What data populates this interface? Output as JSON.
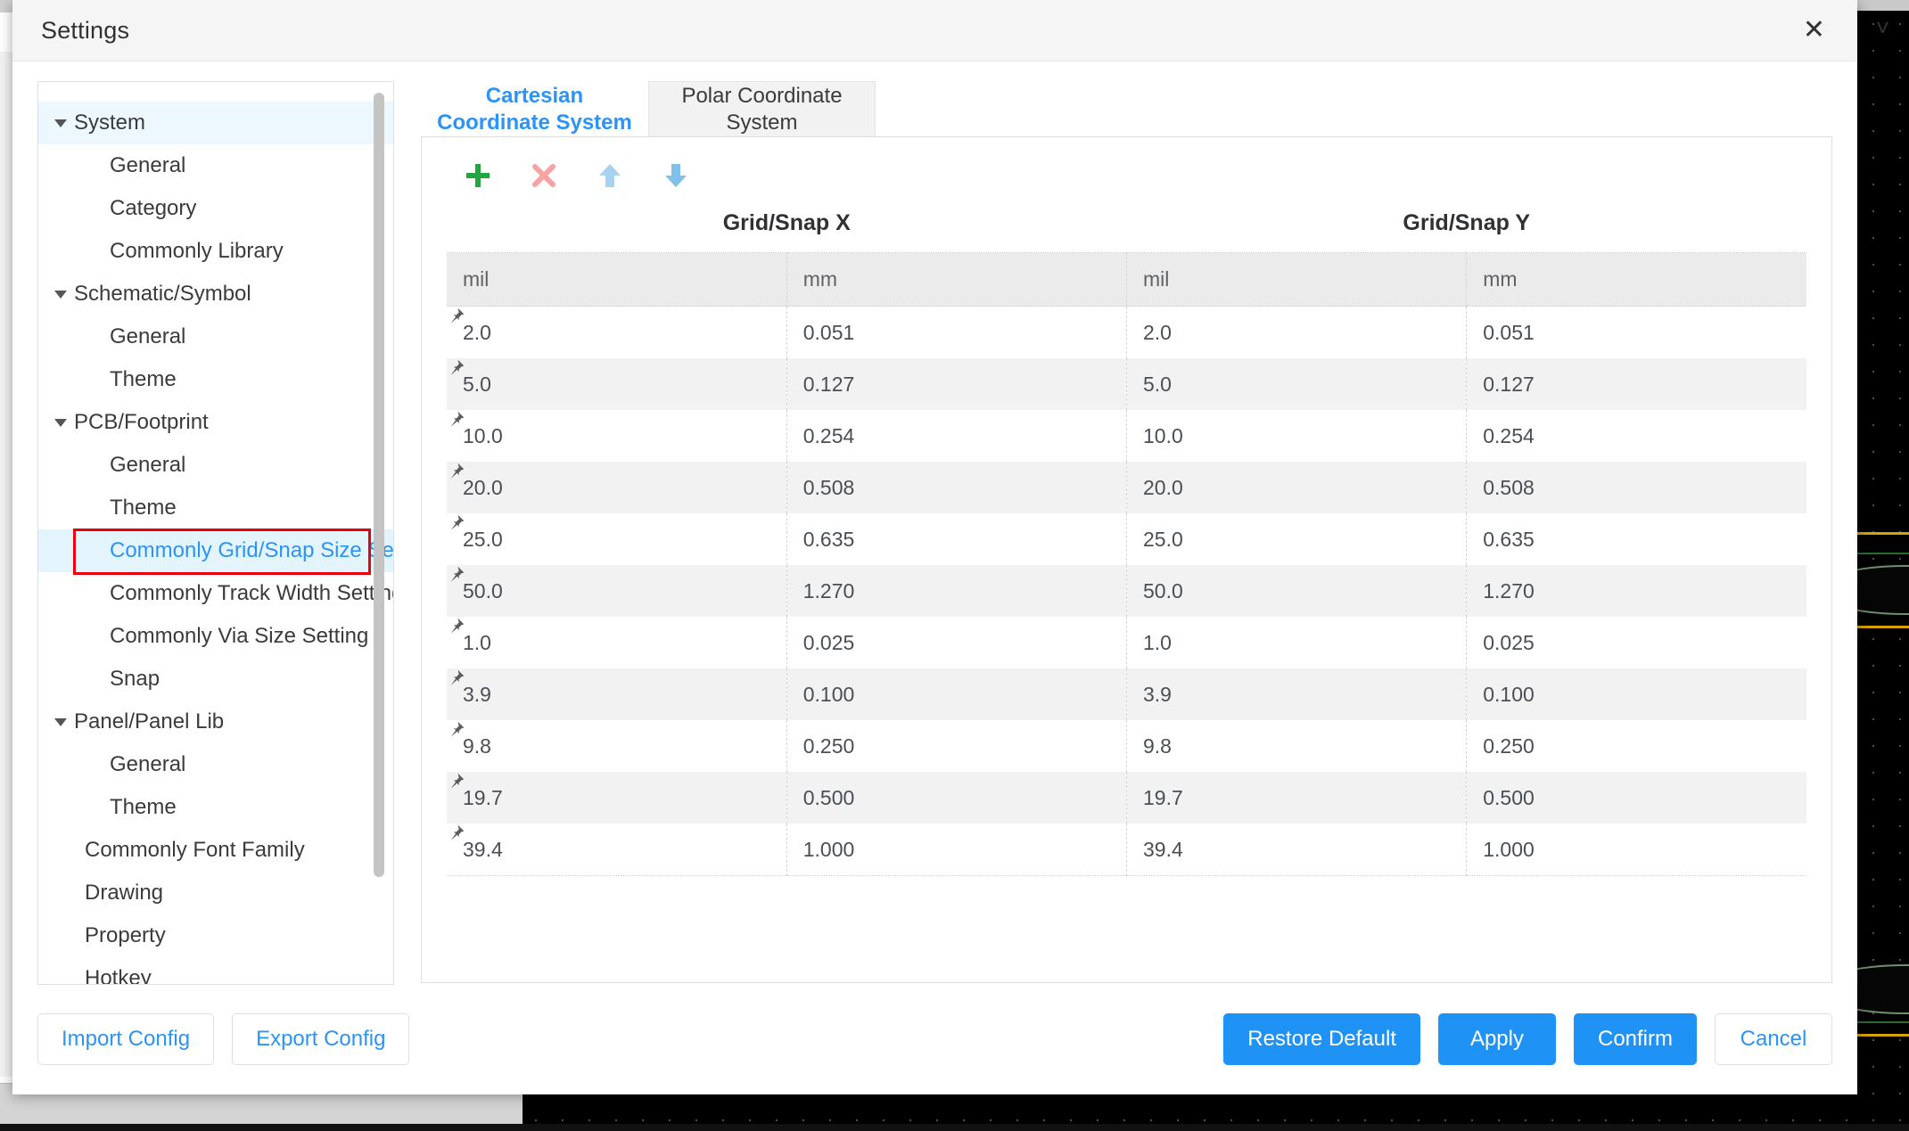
{
  "dialog": {
    "title": "Settings",
    "close_icon": "close-icon"
  },
  "sidebar": {
    "items": [
      {
        "label": "System",
        "level": 0,
        "expandable": true,
        "state": "selected-parent"
      },
      {
        "label": "General",
        "level": 1,
        "expandable": false,
        "state": ""
      },
      {
        "label": "Category",
        "level": 1,
        "expandable": false,
        "state": ""
      },
      {
        "label": "Commonly Library",
        "level": 1,
        "expandable": false,
        "state": ""
      },
      {
        "label": "Schematic/Symbol",
        "level": 0,
        "expandable": true,
        "state": ""
      },
      {
        "label": "General",
        "level": 1,
        "expandable": false,
        "state": ""
      },
      {
        "label": "Theme",
        "level": 1,
        "expandable": false,
        "state": ""
      },
      {
        "label": "PCB/Footprint",
        "level": 0,
        "expandable": true,
        "state": ""
      },
      {
        "label": "General",
        "level": 1,
        "expandable": false,
        "state": ""
      },
      {
        "label": "Theme",
        "level": 1,
        "expandable": false,
        "state": ""
      },
      {
        "label": "Commonly Grid/Snap Size Setting",
        "level": 1,
        "expandable": false,
        "state": "active"
      },
      {
        "label": "Commonly Track Width Setting",
        "level": 1,
        "expandable": false,
        "state": ""
      },
      {
        "label": "Commonly Via Size Setting",
        "level": 1,
        "expandable": false,
        "state": ""
      },
      {
        "label": "Snap",
        "level": 1,
        "expandable": false,
        "state": ""
      },
      {
        "label": "Panel/Panel Lib",
        "level": 0,
        "expandable": true,
        "state": ""
      },
      {
        "label": "General",
        "level": 1,
        "expandable": false,
        "state": ""
      },
      {
        "label": "Theme",
        "level": 1,
        "expandable": false,
        "state": ""
      },
      {
        "label": "Commonly Font Family",
        "level": 0,
        "expandable": false,
        "state": ""
      },
      {
        "label": "Drawing",
        "level": 0,
        "expandable": false,
        "state": ""
      },
      {
        "label": "Property",
        "level": 0,
        "expandable": false,
        "state": ""
      },
      {
        "label": "Hotkey",
        "level": 0,
        "expandable": false,
        "state": ""
      }
    ]
  },
  "main": {
    "tabs": [
      {
        "label": "Cartesian Coordinate System",
        "active": true
      },
      {
        "label": "Polar Coordinate System",
        "active": false
      }
    ],
    "toolbar": [
      {
        "name": "add-icon",
        "glyph": "+",
        "color": "#22a63f"
      },
      {
        "name": "delete-icon",
        "glyph": "x",
        "color": "#f7a7a7"
      },
      {
        "name": "move-up-icon",
        "glyph": "up",
        "color": "#a8d3f0"
      },
      {
        "name": "move-down-icon",
        "glyph": "down",
        "color": "#7fc0ec"
      }
    ],
    "column_groups": [
      "Grid/Snap X",
      "Grid/Snap Y"
    ],
    "table": {
      "headers": [
        "mil",
        "mm",
        "mil",
        "mm"
      ],
      "rows": [
        [
          "2.0",
          "0.051",
          "2.0",
          "0.051"
        ],
        [
          "5.0",
          "0.127",
          "5.0",
          "0.127"
        ],
        [
          "10.0",
          "0.254",
          "10.0",
          "0.254"
        ],
        [
          "20.0",
          "0.508",
          "20.0",
          "0.508"
        ],
        [
          "25.0",
          "0.635",
          "25.0",
          "0.635"
        ],
        [
          "50.0",
          "1.270",
          "50.0",
          "1.270"
        ],
        [
          "1.0",
          "0.025",
          "1.0",
          "0.025"
        ],
        [
          "3.9",
          "0.100",
          "3.9",
          "0.100"
        ],
        [
          "9.8",
          "0.250",
          "9.8",
          "0.250"
        ],
        [
          "19.7",
          "0.500",
          "19.7",
          "0.500"
        ],
        [
          "39.4",
          "1.000",
          "39.4",
          "1.000"
        ]
      ]
    }
  },
  "footer": {
    "left_buttons": [
      {
        "label": "Import Config",
        "style": "ghost"
      },
      {
        "label": "Export Config",
        "style": "ghost"
      }
    ],
    "right_buttons": [
      {
        "label": "Restore Default",
        "style": "primary"
      },
      {
        "label": "Apply",
        "style": "primary"
      },
      {
        "label": "Confirm",
        "style": "primary"
      },
      {
        "label": "Cancel",
        "style": "ghost"
      }
    ]
  },
  "colors": {
    "accent": "#2c94f5",
    "primary_button": "#1f92f5",
    "active_row": "#e3f4fd",
    "highlight_outline": "#e8000d",
    "tab_inactive_bg": "#f2f2f2"
  }
}
